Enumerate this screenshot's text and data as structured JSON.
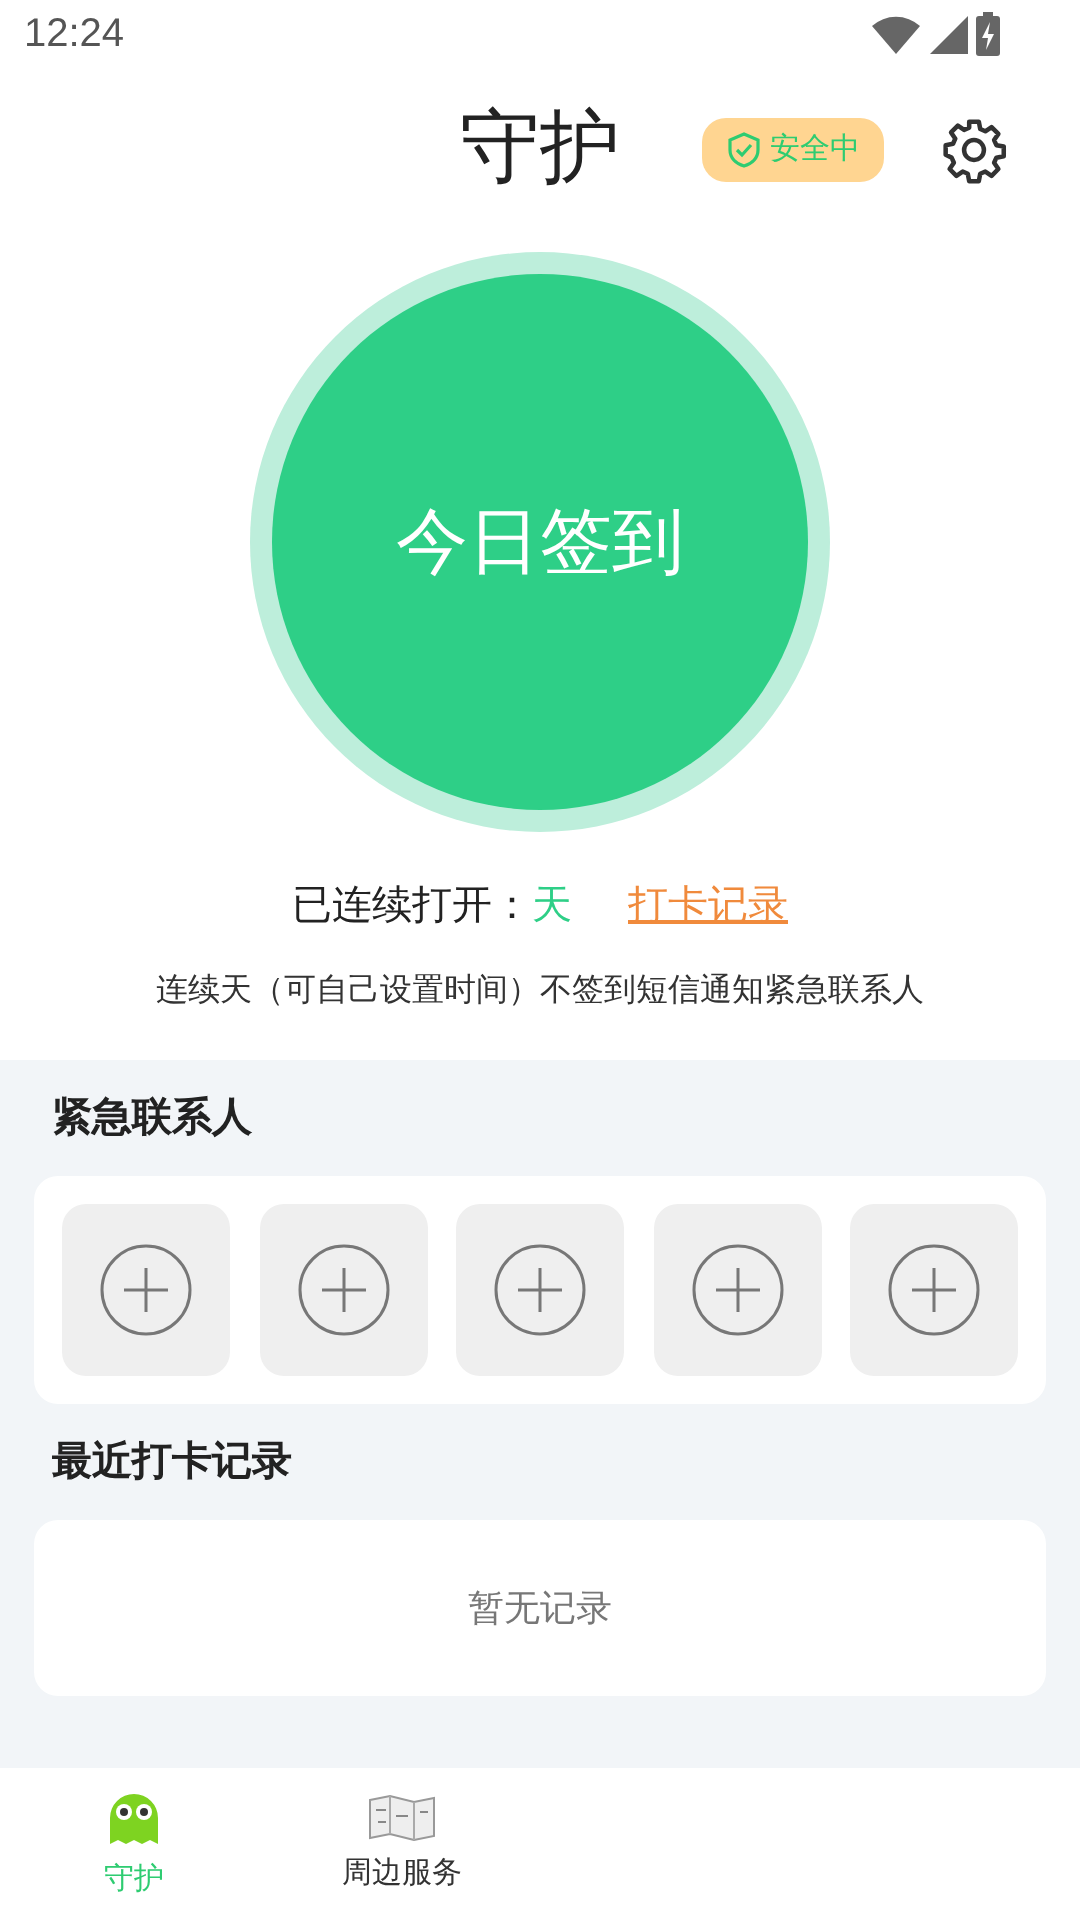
{
  "status_bar": {
    "time": "12:24"
  },
  "header": {
    "title": "守护",
    "badge": "安全中"
  },
  "checkin": {
    "button": "今日签到",
    "streak_label": "已连续打开：",
    "streak_value": "天",
    "record_link": "打卡记录",
    "note": "连续天（可自己设置时间）不签到短信通知紧急联系人"
  },
  "contacts": {
    "title": "紧急联系人",
    "slots": [
      {
        "kind": "add"
      },
      {
        "kind": "add"
      },
      {
        "kind": "add"
      },
      {
        "kind": "add"
      },
      {
        "kind": "add"
      }
    ]
  },
  "records": {
    "title": "最近打卡记录",
    "empty": "暂无记录"
  },
  "bottom_nav": [
    {
      "label": "守护",
      "selected": true,
      "kind": "ghost"
    },
    {
      "label": "周边服务",
      "selected": false,
      "kind": "map"
    }
  ]
}
